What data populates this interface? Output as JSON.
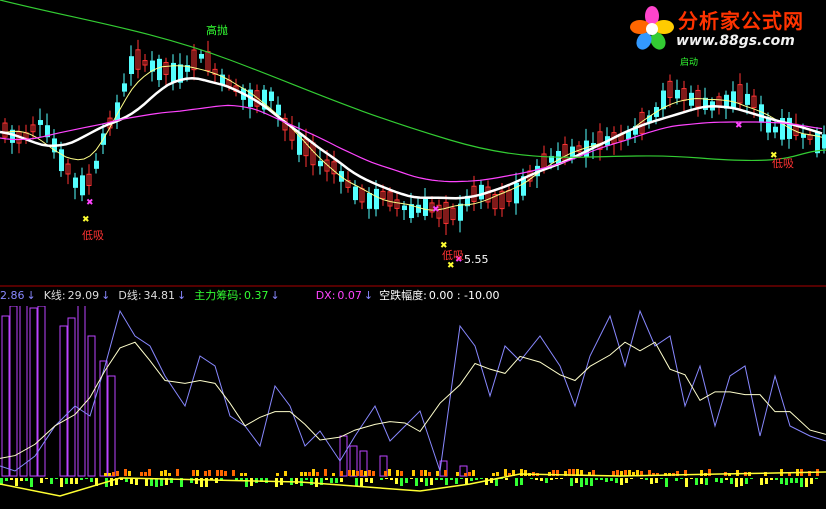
{
  "annotations": {
    "high_sell": "高抛",
    "low_buy_1": "低吸",
    "low_buy_2": "低吸",
    "low_buy_3": "低吸",
    "start": "启动",
    "price_low": "5.55"
  },
  "logo": {
    "title": "分析家公式网",
    "url": "www.88gs.com"
  },
  "indicator": {
    "first_value": "2.86",
    "k_label": "K线:",
    "k_value": "29.09",
    "d_label": "D线:",
    "d_value": "34.81",
    "chip_label": "主力筹码:",
    "chip_value": "0.37",
    "dx_label": "DX:",
    "dx_value": "0.07",
    "drop_label": "空跌幅度:",
    "drop_values": "0.00 : -10.00",
    "arrow": "↓"
  },
  "colors": {
    "up_candle": "#ff3333",
    "down_candle": "#54ffff",
    "ma_white": "#ffffff",
    "ma_magenta": "#ff44ff",
    "ma_green": "#33cc33",
    "ma_yellow": "#ffff88",
    "k_line": "#8888ff",
    "d_line": "#ffffcc",
    "divider": "#aa0000"
  }
}
